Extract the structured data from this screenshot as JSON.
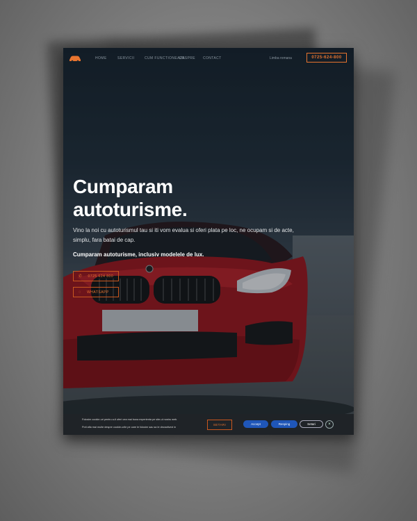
{
  "nav": {
    "links": [
      "Home",
      "Servicii",
      "Cum functioneaza",
      "Despre",
      "Contact"
    ],
    "language": "Limba romana",
    "phone": "0725-624-800"
  },
  "hero": {
    "title_line1": "Cumparam",
    "title_line2": "autoturisme.",
    "lead": "Vino la noi cu autoturismul tau si iti vom evalua si oferi plata pe loc, ne ocupam si de acte, simplu, fara batai de cap.",
    "subtitle": "Cumparam autoturisme, inclusiv modelele de lux.",
    "phone_button": "0725 624 800",
    "whatsapp_button": "WHATSAPP"
  },
  "cookie": {
    "line1": "Folosim cookie-uri pentru a-ti oferi cea mai buna experienta pe site-ul nostru web.",
    "line2": "Poti afla mai multe despre cookie-urile pe care le folosim sau sa le dezactivezi in",
    "settings_link": "SETARI",
    "accept": "Accept",
    "reject": "Resping",
    "settings": "Setari",
    "close": "×"
  },
  "colors": {
    "accent": "#e8742f",
    "button_blue": "#1f56b8"
  }
}
